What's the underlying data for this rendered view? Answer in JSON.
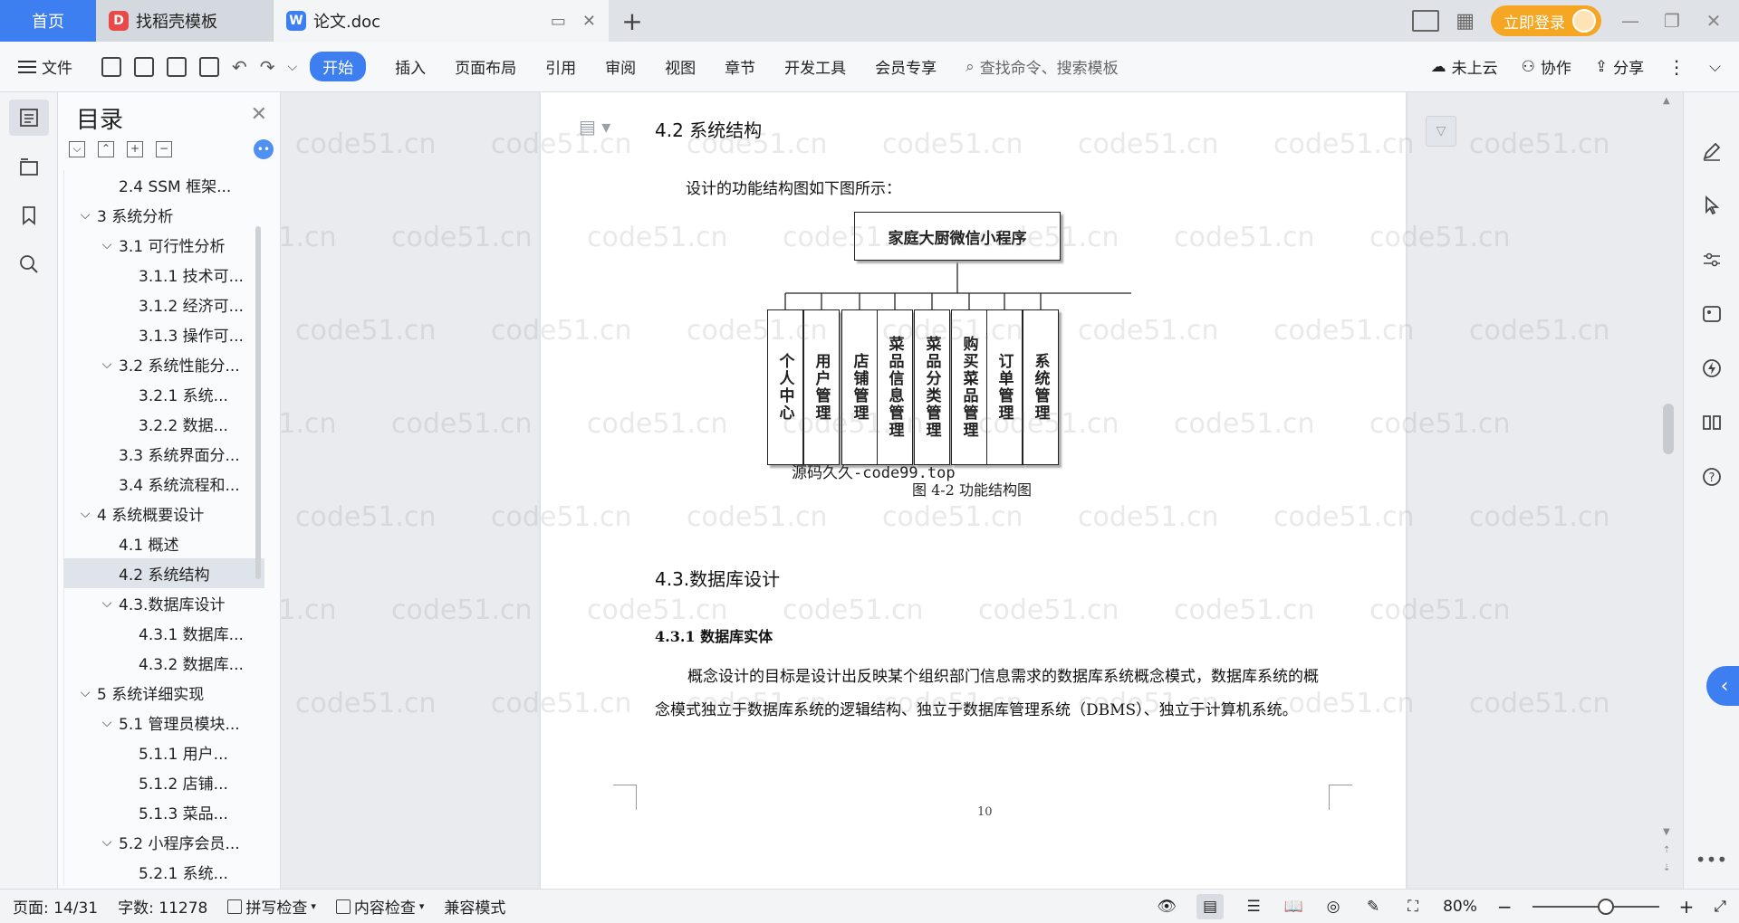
{
  "tabs": {
    "home": "首页",
    "tab1": "找稻壳模板",
    "tab2": "论文.doc",
    "login": "立即登录"
  },
  "menu": {
    "file": "文件",
    "items": [
      "开始",
      "插入",
      "页面布局",
      "引用",
      "审阅",
      "视图",
      "章节",
      "开发工具",
      "会员专享"
    ],
    "search": "查找命令、搜索模板",
    "cloud": "未上云",
    "collab": "协作",
    "share": "分享"
  },
  "toc": {
    "title": "目录",
    "items": [
      {
        "level": "l2 leaf",
        "arrow": "",
        "label": "2.4 SSM 框架..."
      },
      {
        "level": "l1",
        "arrow": "⌵",
        "label": "3 系统分析"
      },
      {
        "level": "l2",
        "arrow": "⌵",
        "label": "3.1 可行性分析"
      },
      {
        "level": "l3",
        "arrow": "",
        "label": "3.1.1 技术可..."
      },
      {
        "level": "l3",
        "arrow": "",
        "label": "3.1.2 经济可..."
      },
      {
        "level": "l3",
        "arrow": "",
        "label": "3.1.3 操作可..."
      },
      {
        "level": "l2",
        "arrow": "⌵",
        "label": "3.2 系统性能分..."
      },
      {
        "level": "l3",
        "arrow": "",
        "label": "3.2.1  系统..."
      },
      {
        "level": "l3",
        "arrow": "",
        "label": "3.2.2  数据..."
      },
      {
        "level": "l2 leaf",
        "arrow": "",
        "label": "3.3 系统界面分..."
      },
      {
        "level": "l2 leaf",
        "arrow": "",
        "label": "3.4 系统流程和..."
      },
      {
        "level": "l1",
        "arrow": "⌵",
        "label": "4 系统概要设计"
      },
      {
        "level": "l2 leaf",
        "arrow": "",
        "label": "4.1 概述"
      },
      {
        "level": "l2 leaf selected",
        "arrow": "",
        "label": "4.2 系统结构"
      },
      {
        "level": "l2",
        "arrow": "⌵",
        "label": "4.3.数据库设计"
      },
      {
        "level": "l3",
        "arrow": "",
        "label": "4.3.1 数据库..."
      },
      {
        "level": "l3",
        "arrow": "",
        "label": "4.3.2 数据库..."
      },
      {
        "level": "l1",
        "arrow": "⌵",
        "label": "5 系统详细实现"
      },
      {
        "level": "l2",
        "arrow": "⌵",
        "label": "5.1  管理员模块..."
      },
      {
        "level": "l3",
        "arrow": "",
        "label": "5.1.1  用户..."
      },
      {
        "level": "l3",
        "arrow": "",
        "label": "5.1.2  店铺..."
      },
      {
        "level": "l3",
        "arrow": "",
        "label": "5.1.3  菜品..."
      },
      {
        "level": "l2",
        "arrow": "⌵",
        "label": "5.2  小程序会员..."
      },
      {
        "level": "l3",
        "arrow": "",
        "label": "5.2.1  系统..."
      }
    ]
  },
  "doc": {
    "heading_42": "4.2 系统结构",
    "intro": "设计的功能结构图如下图所示：",
    "chart_root": "家庭大厨微信小程序",
    "chart_boxes": [
      "个人中心",
      "用户管理",
      "店铺管理",
      "菜品信息管理",
      "菜品分类管理",
      "购买菜品管理",
      "订单管理",
      "系统管理"
    ],
    "overlay": "源码久久-code99.top",
    "caption": "图 4-2 功能结构图",
    "heading_43": "4.3.数据库设计",
    "heading_431": "4.3.1 数据库实体",
    "body": "概念设计的目标是设计出反映某个组织部门信息需求的数据库系统概念模式，数据库系统的概念模式独立于数据库系统的逻辑结构、独立于数据库管理系统（DBMS）、独立于计算机系统。",
    "page_number": "10",
    "watermark": "code51.cn"
  },
  "status": {
    "page": "页面: 14/31",
    "words": "字数: 11278",
    "spell": "拼写检查",
    "content": "内容检查",
    "compat": "兼容模式",
    "zoom": "80%"
  },
  "colors": {
    "accent": "#3d7ff0",
    "login": "#f5a623"
  }
}
